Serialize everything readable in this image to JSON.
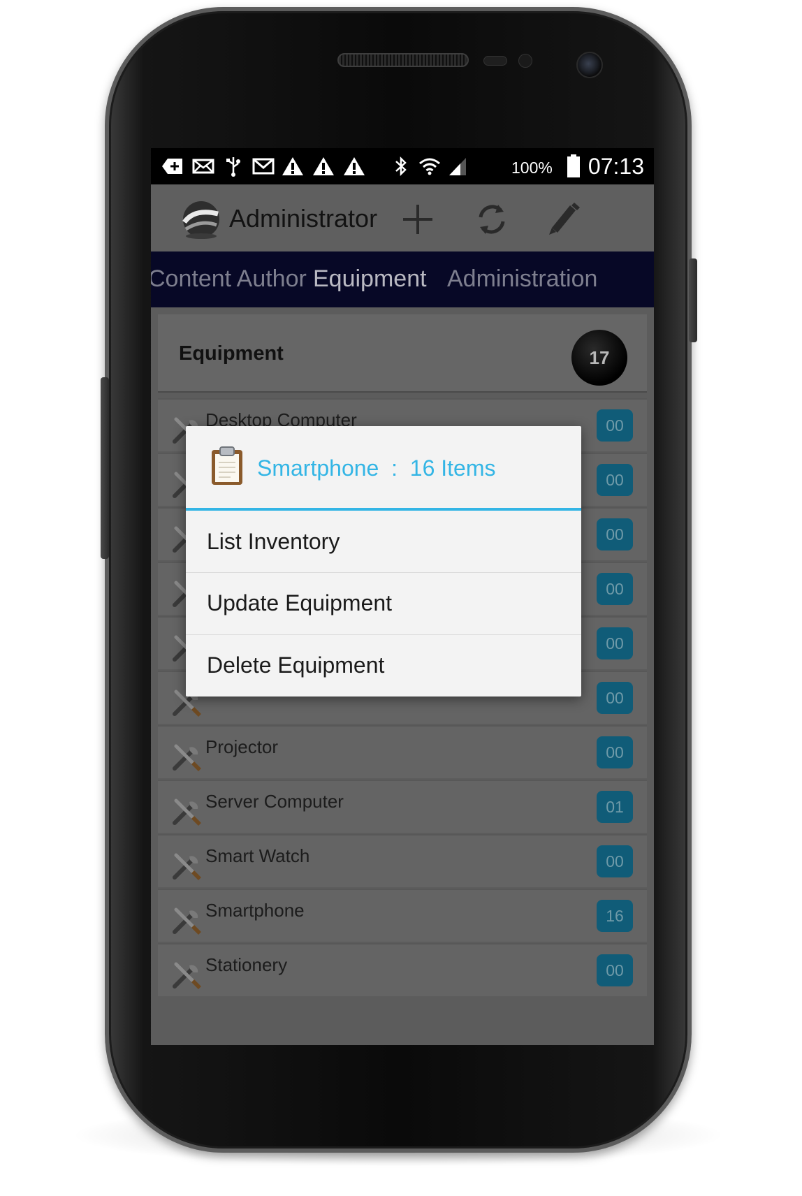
{
  "status_bar": {
    "battery_percent": "100%",
    "time": "07:13",
    "icons": [
      "add-notification-icon",
      "mail-icon",
      "usb-icon",
      "gmail-icon",
      "warning-icon",
      "warning-icon",
      "warning-icon",
      "bluetooth-icon",
      "wifi-icon",
      "signal-icon",
      "battery-icon"
    ]
  },
  "action_bar": {
    "title": "Administrator",
    "actions": [
      "add-icon",
      "refresh-icon",
      "edit-icon"
    ]
  },
  "tabs": [
    {
      "label": "Content Author",
      "active": false
    },
    {
      "label": "Equipment",
      "active": true
    },
    {
      "label": "Administration",
      "active": false
    }
  ],
  "list": {
    "header": {
      "title": "Equipment",
      "count": "17"
    },
    "rows": [
      {
        "label": "Desktop Computer",
        "badge": "00"
      },
      {
        "label": "",
        "badge": "00"
      },
      {
        "label": "",
        "badge": "00"
      },
      {
        "label": "",
        "badge": "00"
      },
      {
        "label": "",
        "badge": "00"
      },
      {
        "label": "",
        "badge": "00"
      },
      {
        "label": "Projector",
        "badge": "00"
      },
      {
        "label": "Server Computer",
        "badge": "01"
      },
      {
        "label": "Smart Watch",
        "badge": "00"
      },
      {
        "label": "Smartphone",
        "badge": "16"
      },
      {
        "label": "Stationery",
        "badge": "00"
      }
    ]
  },
  "dialog": {
    "title": "Smartphone  :  16 Items",
    "items": [
      "List Inventory",
      "Update Equipment",
      "Delete Equipment"
    ]
  },
  "colors": {
    "accent": "#33b5e5",
    "badge_bg": "#105c78",
    "tab_bar_bg": "#070826"
  }
}
